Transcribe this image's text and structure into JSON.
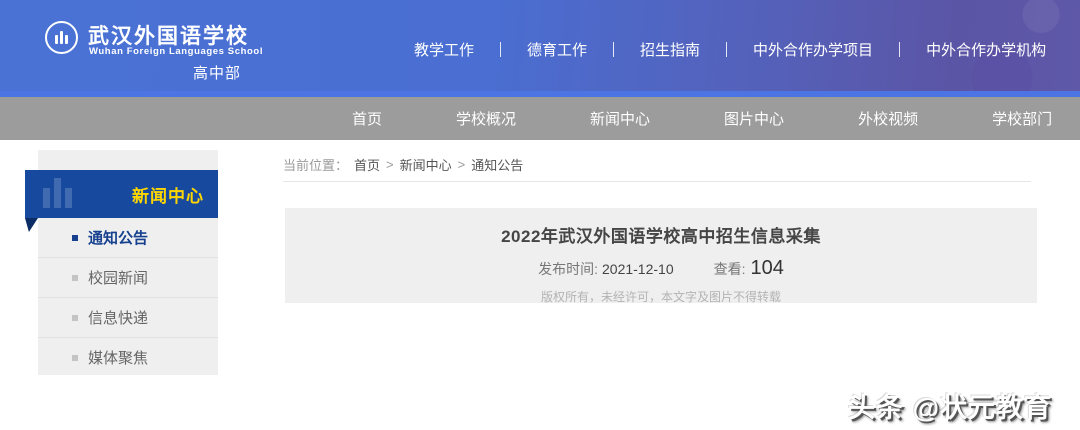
{
  "header": {
    "school_name_cn": "武汉外国语学校",
    "school_name_en": "Wuhan Foreign Languages School",
    "division": "高中部",
    "top_links": [
      "教学工作",
      "德育工作",
      "招生指南",
      "中外合作办学项目",
      "中外合作办学机构"
    ]
  },
  "nav": {
    "items": [
      "首页",
      "学校概况",
      "新闻中心",
      "图片中心",
      "外校视频",
      "学校部门"
    ]
  },
  "sidebar": {
    "title": "新闻中心",
    "items": [
      {
        "label": "通知公告",
        "active": true
      },
      {
        "label": "校园新闻",
        "active": false
      },
      {
        "label": "信息快递",
        "active": false
      },
      {
        "label": "媒体聚焦",
        "active": false
      }
    ]
  },
  "breadcrumb": {
    "label": "当前位置：",
    "separator": ">",
    "path": [
      "首页",
      "新闻中心",
      "通知公告"
    ]
  },
  "article": {
    "title": "2022年武汉外国语学校高中招生信息采集",
    "publish_label": "发布时间:",
    "publish_date": "2021-12-10",
    "views_label": "查看:",
    "views_count": "104",
    "copyright": "版权所有，未经许可，本文字及图片不得转载"
  },
  "watermark": {
    "text": "头条 @状元教育"
  },
  "colors": {
    "header_blue": "#4a72d4",
    "header_purple": "#5b55a6",
    "header_bottom_strip": "#4c74e2",
    "nav_gray": "#9c9c9c",
    "sidebar_blue": "#174a9f",
    "sidebar_title_yellow": "#ffd700",
    "active_item_blue": "#17418f",
    "panel_gray": "#efefef"
  }
}
